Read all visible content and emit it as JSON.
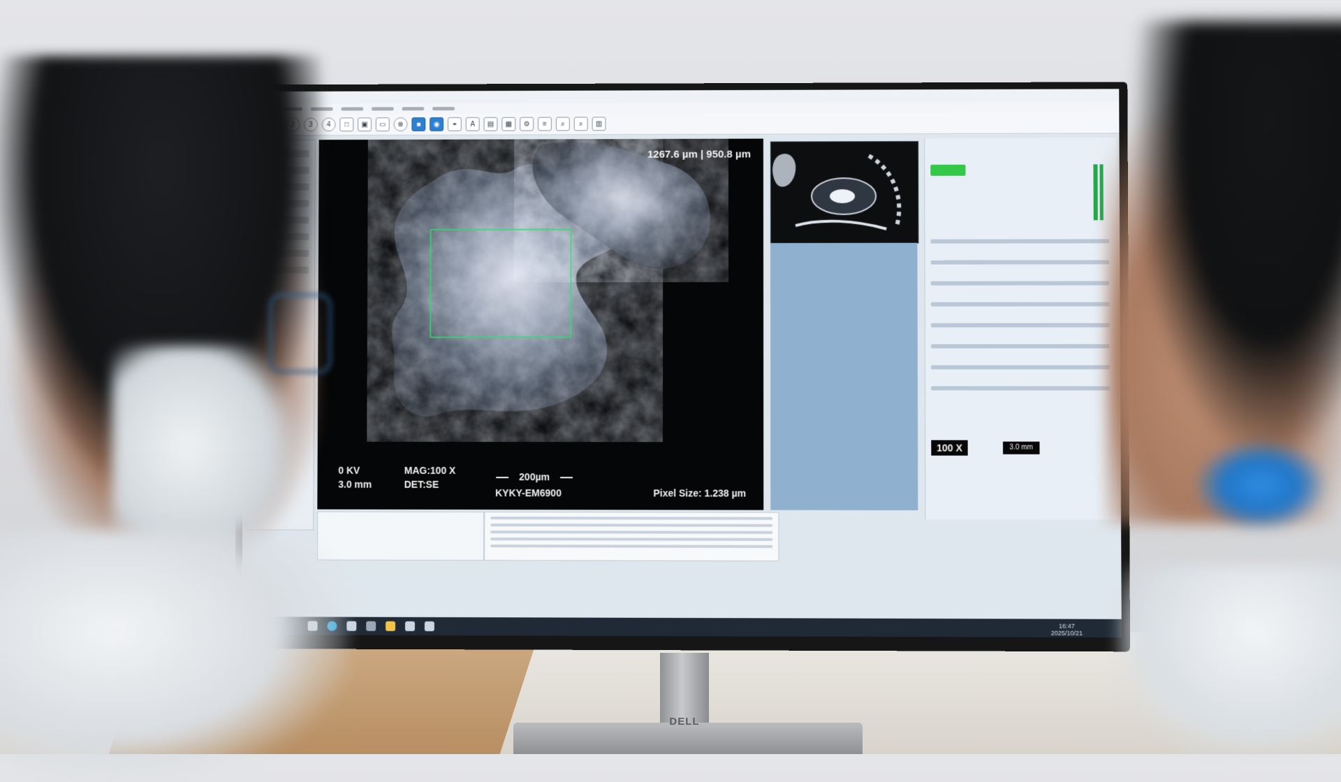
{
  "scene": {
    "description_labels": {
      "monitor_brand": "DELL"
    }
  },
  "sem_overlay": {
    "field_size": "1267.6 µm | 950.8 µm",
    "kv": "0 KV",
    "wd": "3.0 mm",
    "magnification": "MAG:100 X",
    "detector": "DET:SE",
    "scale": "200µm",
    "model": "KYKY-EM6900",
    "pixel_size": "Pixel Size: 1.238 µm"
  },
  "controls": {
    "magnification_box": "100 X",
    "working_distance_box": "3.0 mm"
  },
  "taskbar": {
    "time": "16:47",
    "date": "2025/10/21"
  },
  "toolbar_icons": [
    "home-icon",
    "number-1-icon",
    "number-2-icon",
    "number-3-icon",
    "number-4-icon",
    "document-icon",
    "document-icon",
    "screen-icon",
    "close-circle-icon",
    "save-icon",
    "camera-icon",
    "focus-icon",
    "text-icon",
    "tv-icon",
    "calendar-icon",
    "settings-icon",
    "measure-icon",
    "zoom-in-icon",
    "zoom-out-icon",
    "layers-icon"
  ]
}
